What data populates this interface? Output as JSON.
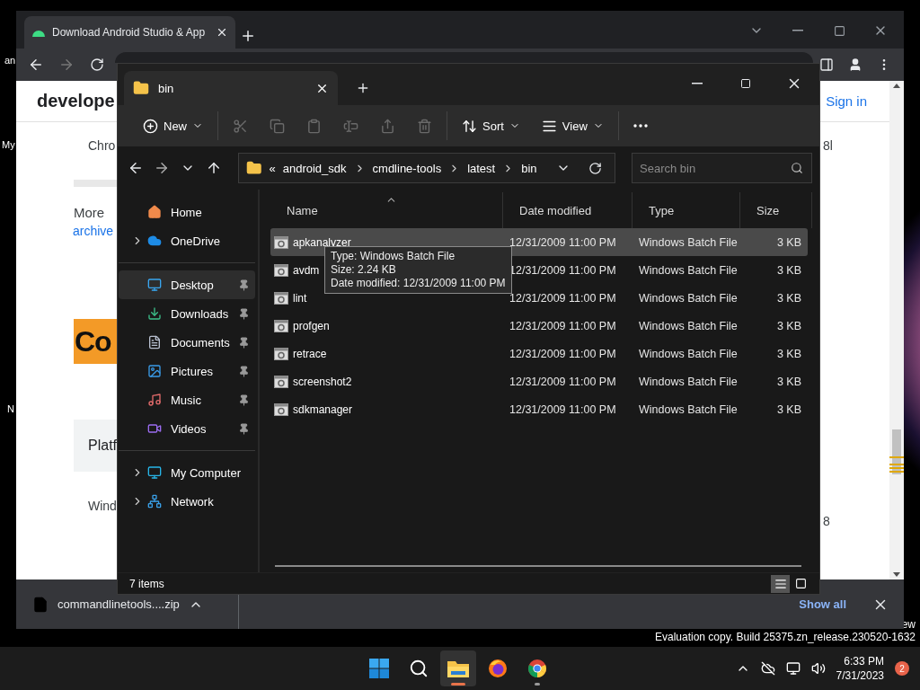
{
  "desktop": {
    "icon_labels": [
      "an",
      "My",
      "N"
    ],
    "watermark_lines": [
      "ew",
      "Evaluation copy. Build 25375.zn_release.230520-1632"
    ]
  },
  "browser": {
    "tabs": [
      {
        "title": "Download Android Studio & App",
        "selected": true
      }
    ],
    "page": {
      "logo": "develope",
      "sign_in": "Sign in",
      "left_texts": [
        "Chro",
        "More",
        "archive"
      ],
      "banner": "Co",
      "panel_heading": "Platf",
      "left_row": "Wind",
      "right_texts": [
        "8l",
        "8"
      ]
    },
    "download_bar": {
      "file": "commandlinetools....zip",
      "show_all": "Show all"
    }
  },
  "explorer": {
    "tabs": [
      {
        "title": "bin",
        "selected": true
      }
    ],
    "commands": [
      [
        {
          "kind": "new",
          "label": "New",
          "disabled": false
        }
      ],
      [
        {
          "kind": "cut",
          "disabled": true
        },
        {
          "kind": "copy",
          "disabled": true
        },
        {
          "kind": "paste",
          "disabled": true
        },
        {
          "kind": "rename",
          "disabled": true
        },
        {
          "kind": "share",
          "disabled": true
        },
        {
          "kind": "delete",
          "disabled": true
        }
      ],
      [
        {
          "kind": "sort",
          "label": "Sort",
          "disabled": false
        },
        {
          "kind": "view",
          "label": "View",
          "disabled": false
        }
      ],
      [
        {
          "kind": "more",
          "disabled": false
        }
      ]
    ],
    "address": {
      "overflow": "«",
      "path": [
        "android_sdk",
        "cmdline-tools",
        "latest",
        "bin"
      ]
    },
    "search": {
      "placeholder": "Search bin"
    },
    "nav_groups": [
      [
        {
          "kind": "home",
          "label": "Home",
          "expandable": false,
          "pinned": false,
          "selected": false
        },
        {
          "kind": "cloud",
          "label": "OneDrive",
          "expandable": true,
          "pinned": false,
          "selected": false
        }
      ],
      [
        {
          "kind": "desktop",
          "label": "Desktop",
          "expandable": false,
          "pinned": true,
          "selected": true
        },
        {
          "kind": "downloads",
          "label": "Downloads",
          "expandable": false,
          "pinned": true,
          "selected": false
        },
        {
          "kind": "documents",
          "label": "Documents",
          "expandable": false,
          "pinned": true,
          "selected": false
        },
        {
          "kind": "pictures",
          "label": "Pictures",
          "expandable": false,
          "pinned": true,
          "selected": false
        },
        {
          "kind": "music",
          "label": "Music",
          "expandable": false,
          "pinned": true,
          "selected": false
        },
        {
          "kind": "videos",
          "label": "Videos",
          "expandable": false,
          "pinned": true,
          "selected": false
        }
      ],
      [
        {
          "kind": "computer",
          "label": "My Computer",
          "expandable": true,
          "pinned": false,
          "selected": false
        },
        {
          "kind": "network",
          "label": "Network",
          "expandable": true,
          "pinned": false,
          "selected": false
        }
      ]
    ],
    "columns": [
      {
        "label": "Name",
        "sorted": true
      },
      {
        "label": "Date modified",
        "sorted": false
      },
      {
        "label": "Type",
        "sorted": false
      },
      {
        "label": "Size",
        "sorted": false
      }
    ],
    "rows": [
      {
        "name": "apkanalyzer",
        "date": "12/31/2009 11:00 PM",
        "type": "Windows Batch File",
        "size": "3 KB",
        "selected": true
      },
      {
        "name": "avdm",
        "date": "12/31/2009 11:00 PM",
        "type": "Windows Batch File",
        "size": "3 KB",
        "selected": false
      },
      {
        "name": "lint",
        "date": "12/31/2009 11:00 PM",
        "type": "Windows Batch File",
        "size": "3 KB",
        "selected": false
      },
      {
        "name": "profgen",
        "date": "12/31/2009 11:00 PM",
        "type": "Windows Batch File",
        "size": "3 KB",
        "selected": false
      },
      {
        "name": "retrace",
        "date": "12/31/2009 11:00 PM",
        "type": "Windows Batch File",
        "size": "3 KB",
        "selected": false
      },
      {
        "name": "screenshot2",
        "date": "12/31/2009 11:00 PM",
        "type": "Windows Batch File",
        "size": "3 KB",
        "selected": false
      },
      {
        "name": "sdkmanager",
        "date": "12/31/2009 11:00 PM",
        "type": "Windows Batch File",
        "size": "3 KB",
        "selected": false
      }
    ],
    "tooltip": [
      "Type: Windows Batch File",
      "Size: 2.24 KB",
      "Date modified: 12/31/2009 11:00 PM"
    ],
    "status": "7 items",
    "views": [
      {
        "kind": "details",
        "selected": true
      },
      {
        "kind": "tiles",
        "selected": false
      }
    ]
  },
  "taskbar": {
    "apps": [
      {
        "kind": "start",
        "selected": false,
        "running": false
      },
      {
        "kind": "search",
        "selected": false,
        "running": false
      },
      {
        "kind": "explorer",
        "selected": true,
        "running": true
      },
      {
        "kind": "firefox",
        "selected": false,
        "running": false
      },
      {
        "kind": "chrome",
        "selected": false,
        "running": true
      }
    ],
    "time": "6:33 PM",
    "date": "7/31/2023",
    "notifications": "2"
  }
}
